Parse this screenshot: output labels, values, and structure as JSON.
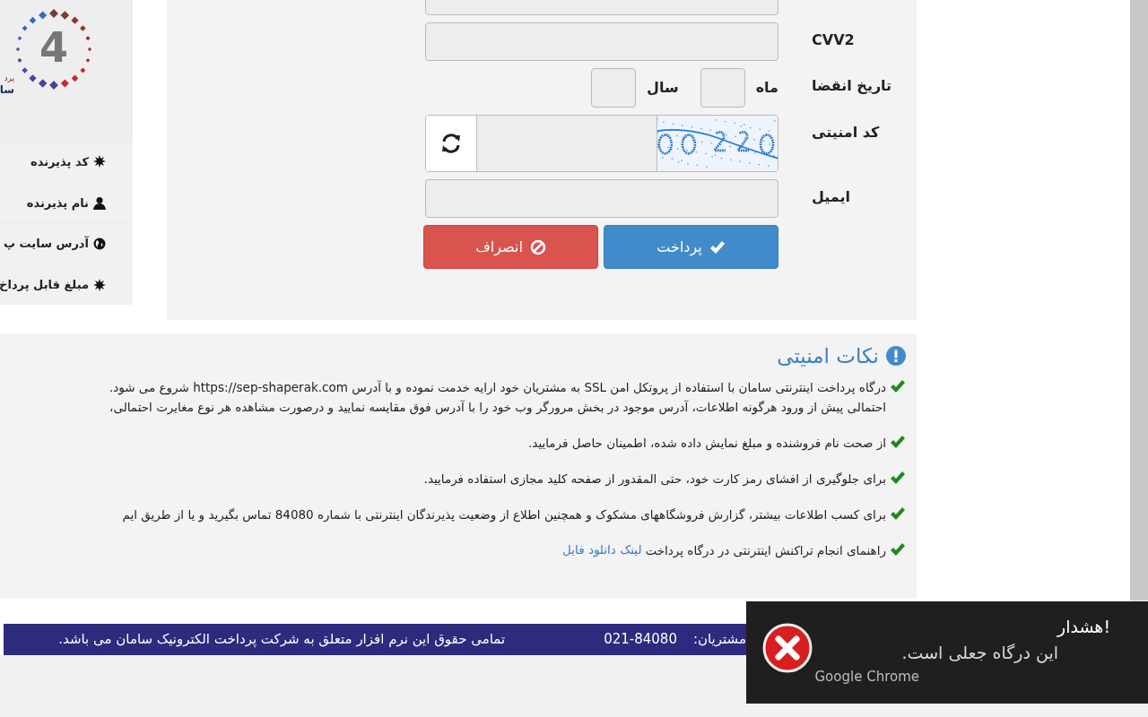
{
  "logo": {
    "mark": "4",
    "text_1": "پرد",
    "text_2": "سا"
  },
  "sidebar": {
    "items": [
      {
        "kind": "asterisk",
        "label": "کد پذیرنده"
      },
      {
        "kind": "user",
        "label": "نام پذیرنده"
      },
      {
        "kind": "globe",
        "label": "آدرس سایت پ"
      },
      {
        "kind": "asterisk",
        "label": "مبلغ قابل پرداخ"
      }
    ]
  },
  "form": {
    "fields": [
      {
        "kind": "text"
      },
      {
        "kind": "text",
        "label": "CVV2"
      },
      {
        "kind": "expiry",
        "label": "تاریخ انقضا",
        "month_label": "ماه",
        "year_label": "سال"
      },
      {
        "kind": "captcha",
        "label": "کد امنیتی"
      },
      {
        "kind": "text",
        "label": "ایمیل"
      }
    ],
    "buttons": [
      {
        "kind": "pay",
        "label": "پرداخت"
      },
      {
        "kind": "cancel",
        "label": "انصراف"
      }
    ]
  },
  "security_notes": {
    "title": "نکات امنیتی",
    "items": [
      {
        "lines": [
          "درگاه پرداخت اینترنتی سامان با استفاده از پروتکل امن SSL به مشتریان خود ارایه خدمت نموده و با آدرس https://sep-shaperak.com شروع می شود.",
          "احتمالی پیش از ورود هرگونه اطلاعات، آدرس موجود در بخش مرورگر وب خود را با آدرس فوق مقایسه نمایید و درصورت مشاهده هر نوع مغایرت احتمالی،"
        ]
      },
      {
        "lines": [
          "از صحت نام فروشنده و مبلغ نمایش داده شده، اطمینان حاصل فرمایید."
        ]
      },
      {
        "lines": [
          "برای جلوگیری از افشای رمز کارت خود، حتی المقدور از صفحه کلید مجازی استفاده فرمایید."
        ]
      },
      {
        "lines": [
          "برای کسب اطلاعات بیشتر، گزارش فروشگاههای مشکوک و همچنین اطلاع از وضعیت پذیرندگان اینترنتی با شماره 84080 تماس بگیرید و یا از طریق ایم"
        ]
      },
      {
        "lines": [
          "راهنمای انجام تراکنش اینترنتی در درگاه پرداخت"
        ],
        "link": "لینک دانلود فایل"
      }
    ]
  },
  "footer": {
    "support_label": "مشتریان:",
    "phone": "021-84080",
    "copyright": "تمامی حقوق این نرم افزار متعلق به شرکت پرداخت الکترونیک سامان می باشد."
  },
  "notification": {
    "title": "هشدار!",
    "message": "این درگاه جعلی است.",
    "source": "Google Chrome"
  }
}
